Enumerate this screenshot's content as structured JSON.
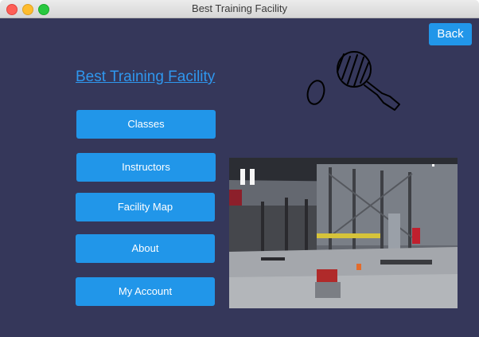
{
  "window": {
    "title": "Best Training Facility"
  },
  "toolbar": {
    "back_label": "Back"
  },
  "main": {
    "heading": "Best Training Facility",
    "menu": [
      {
        "label": "Classes"
      },
      {
        "label": "Instructors"
      },
      {
        "label": "Facility Map"
      },
      {
        "label": "About"
      },
      {
        "label": "My Account"
      }
    ]
  },
  "icons": {
    "logo": "ping-pong-paddle-and-ball-sketch-icon"
  },
  "colors": {
    "background": "#35375a",
    "button": "#2196e9",
    "link": "#2f97ee"
  }
}
